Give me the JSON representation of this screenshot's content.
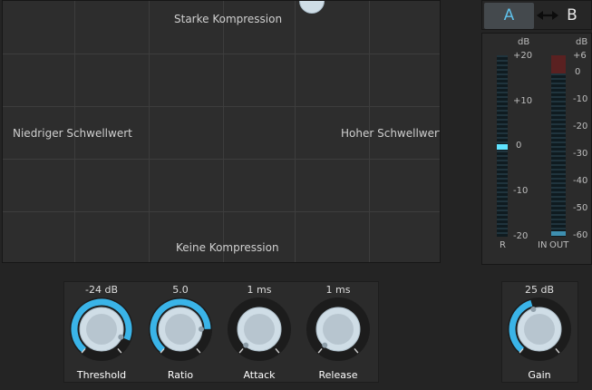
{
  "xy_pad": {
    "label_top": "Starke Kompression",
    "label_bottom": "Keine Kompression",
    "label_left": "Niedriger Schwellwert",
    "label_right": "Hoher Schwellwert"
  },
  "ab_compare": {
    "a_label": "A",
    "b_label": "B",
    "swap_icon": "swap-arrows-icon",
    "active": "A"
  },
  "meters": {
    "left_unit": "dB",
    "right_unit": "dB",
    "left_scale": [
      "+20",
      "+10",
      "0",
      "-10",
      "-20"
    ],
    "right_scale": [
      "+6",
      "0",
      "-10",
      "-20",
      "-30",
      "-40",
      "-50",
      "-60"
    ],
    "left_channel_label": "R",
    "right_channel_label_in": "IN",
    "right_channel_label_out": "OUT"
  },
  "knobs": [
    {
      "id": "threshold",
      "label": "Threshold",
      "value": "-24 dB",
      "level": 0.9
    },
    {
      "id": "ratio",
      "label": "Ratio",
      "value": "5.0",
      "level": 0.82
    },
    {
      "id": "attack",
      "label": "Attack",
      "value": "1 ms",
      "level": 0.0
    },
    {
      "id": "release",
      "label": "Release",
      "value": "1 ms",
      "level": 0.0
    },
    {
      "id": "gain",
      "label": "Gain",
      "value": "25 dB",
      "level": 0.44
    }
  ],
  "colors": {
    "accent": "#3ab4e8",
    "knob_track": "#1c1c1c",
    "knob_face": "#cfdde6",
    "meter_idle": "#20343d",
    "meter_active": "#5fe3ff",
    "meter_clip": "#5a2121"
  }
}
